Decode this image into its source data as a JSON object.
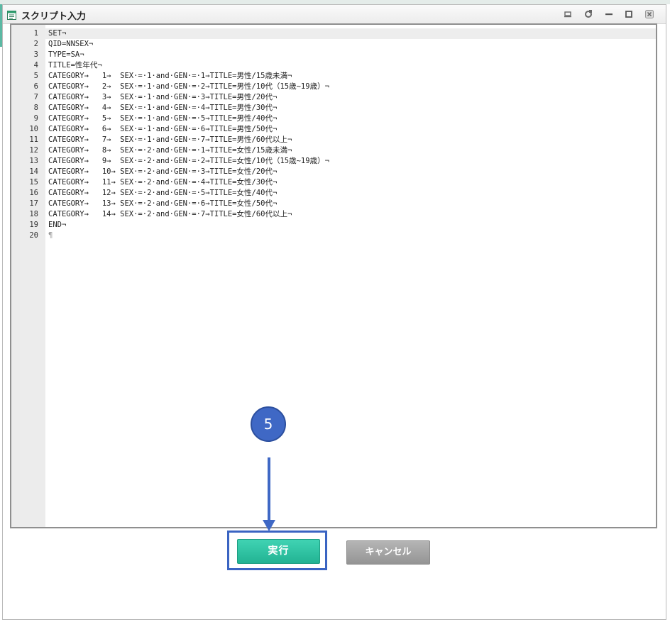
{
  "window": {
    "title": "スクリプト入力"
  },
  "editor": {
    "lines": [
      {
        "n": "1",
        "text": "SET¬"
      },
      {
        "n": "2",
        "text": "QID=NNSEX¬"
      },
      {
        "n": "3",
        "text": "TYPE=SA¬"
      },
      {
        "n": "4",
        "text": "TITLE=性年代¬"
      },
      {
        "n": "5",
        "text": "CATEGORY→   1→  SEX·=·1·and·GEN·=·1→TITLE=男性/15歳未満¬"
      },
      {
        "n": "6",
        "text": "CATEGORY→   2→  SEX·=·1·and·GEN·=·2→TITLE=男性/10代（15歳~19歳）¬"
      },
      {
        "n": "7",
        "text": "CATEGORY→   3→  SEX·=·1·and·GEN·=·3→TITLE=男性/20代¬"
      },
      {
        "n": "8",
        "text": "CATEGORY→   4→  SEX·=·1·and·GEN·=·4→TITLE=男性/30代¬"
      },
      {
        "n": "9",
        "text": "CATEGORY→   5→  SEX·=·1·and·GEN·=·5→TITLE=男性/40代¬"
      },
      {
        "n": "10",
        "text": "CATEGORY→   6→  SEX·=·1·and·GEN·=·6→TITLE=男性/50代¬"
      },
      {
        "n": "11",
        "text": "CATEGORY→   7→  SEX·=·1·and·GEN·=·7→TITLE=男性/60代以上¬"
      },
      {
        "n": "12",
        "text": "CATEGORY→   8→  SEX·=·2·and·GEN·=·1→TITLE=女性/15歳未満¬"
      },
      {
        "n": "13",
        "text": "CATEGORY→   9→  SEX·=·2·and·GEN·=·2→TITLE=女性/10代（15歳~19歳）¬"
      },
      {
        "n": "14",
        "text": "CATEGORY→   10→ SEX·=·2·and·GEN·=·3→TITLE=女性/20代¬"
      },
      {
        "n": "15",
        "text": "CATEGORY→   11→ SEX·=·2·and·GEN·=·4→TITLE=女性/30代¬"
      },
      {
        "n": "16",
        "text": "CATEGORY→   12→ SEX·=·2·and·GEN·=·5→TITLE=女性/40代¬"
      },
      {
        "n": "17",
        "text": "CATEGORY→   13→ SEX·=·2·and·GEN·=·6→TITLE=女性/50代¬"
      },
      {
        "n": "18",
        "text": "CATEGORY→   14→ SEX·=·2·and·GEN·=·7→TITLE=女性/60代以上¬"
      },
      {
        "n": "19",
        "text": "END¬"
      },
      {
        "n": "20",
        "text": "¶"
      }
    ]
  },
  "buttons": {
    "run_label": "実行",
    "cancel_label": "キャンセル"
  },
  "annotation": {
    "step_number": "5",
    "color": "#3f68c5"
  },
  "icons": {
    "title": "script-window-icon",
    "controls": [
      "pin-icon",
      "refresh-icon",
      "minimize-icon",
      "maximize-icon",
      "close-icon"
    ]
  }
}
